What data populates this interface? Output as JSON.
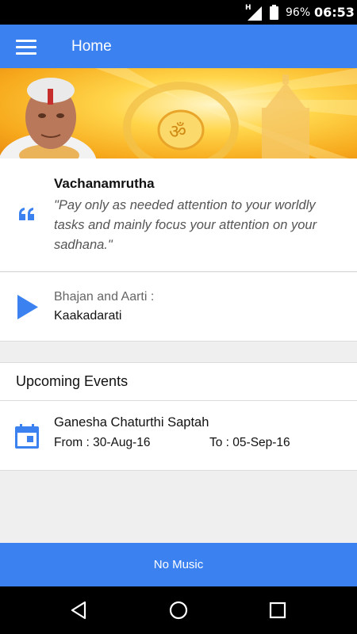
{
  "status_bar": {
    "network": "H",
    "battery_pct": "96%",
    "time": "06:53"
  },
  "app_bar": {
    "title": "Home",
    "menu_icon": "hamburger-menu-icon"
  },
  "banner": {
    "image": "banner-portrait-with-om-symbol"
  },
  "vachanamrutha": {
    "title": "Vachanamrutha",
    "quote": "\"Pay only as needed attention to your worldly tasks and mainly focus your attention on your sadhana.\"",
    "icon": "quote-icon"
  },
  "bhajan": {
    "label": "Bhajan and Aarti :",
    "name": "Kaakadarati",
    "icon": "play-icon"
  },
  "upcoming": {
    "title": "Upcoming Events",
    "events": [
      {
        "name": "Ganesha Chaturthi Saptah",
        "from": "From : 30-Aug-16",
        "to": "To : 05-Sep-16",
        "icon": "calendar-icon"
      }
    ]
  },
  "music_bar": {
    "label": "No Music"
  },
  "nav": {
    "back_icon": "back-icon",
    "home_icon": "home-icon",
    "recents_icon": "recents-icon"
  },
  "colors": {
    "primary": "#3b82f0",
    "status_bar": "#000000",
    "background": "#efefef"
  }
}
